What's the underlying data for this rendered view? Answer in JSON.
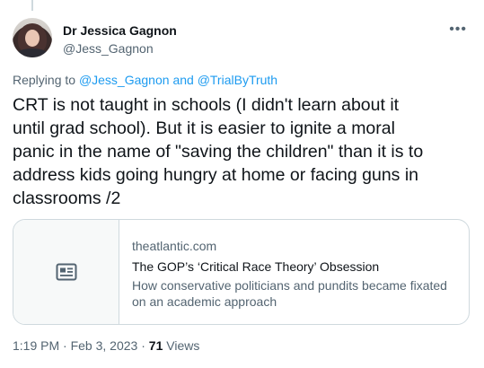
{
  "author": {
    "display_name": "Dr Jessica Gagnon",
    "handle": "@Jess_Gagnon"
  },
  "reply_context": {
    "prefix": "Replying to",
    "mention_1": "@Jess_Gagnon",
    "conjunction": "and",
    "mention_2": "@TrialByTruth"
  },
  "tweet": {
    "text": "CRT is not taught in schools (I didn't learn about it\nuntil grad school). But it is easier to ignite a moral\npanic in the name of \"saving the children\" than it is to\naddress kids going hungry at home or facing guns in\nclassrooms /2"
  },
  "link_card": {
    "domain": "theatlantic.com",
    "title": "The GOP’s ‘Critical Race Theory’ Obsession",
    "description": "How conservative politicians and pundits became fixated on an academic approach",
    "icon": "article-icon"
  },
  "meta": {
    "time": "1:19 PM",
    "separator": "·",
    "date": "Feb 3, 2023",
    "views_count": "71",
    "views_label": "Views"
  },
  "more_icon": "more-options-icon"
}
